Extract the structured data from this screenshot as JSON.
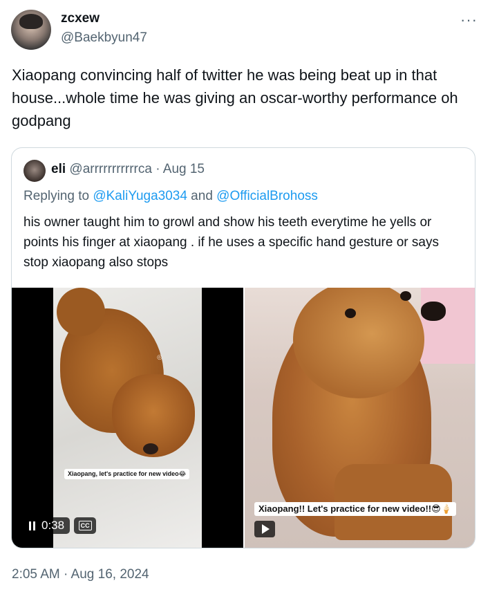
{
  "author": {
    "display_name": "zcxew",
    "handle": "@Baekbyun47"
  },
  "tweet": {
    "text": "Xiaopang convincing half of twitter he was being beat up in that house...whole time he was giving an oscar-worthy performance oh godpang",
    "timestamp": "2:05 AM · Aug 16, 2024"
  },
  "quote": {
    "name": "eli",
    "handle": "@arrrrrrrrrrrca",
    "date": "Aug 15",
    "separator": "·",
    "reply_prefix": "Replying to ",
    "reply_to_1": "@KaliYuga3034",
    "reply_and": " and ",
    "reply_to_2": "@OfficialBrohoss",
    "text": "his owner taught him to growl and show his teeth everytime he yells or points his finger at xiaopang . if he uses a specific hand gesture or says stop xiaopang also stops"
  },
  "media": {
    "left": {
      "caption": "Xiaopang, let's practice for new video😂",
      "duration": "0:38",
      "cc_label": "CC"
    },
    "right": {
      "caption": "Xiaopang!! Let's practice for new video!!😎🍦"
    }
  },
  "icons": {
    "more": "more-horizontal-icon",
    "pause": "pause-icon",
    "cc": "closed-captions-icon",
    "play": "play-icon"
  },
  "colors": {
    "text_primary": "#0f1419",
    "text_secondary": "#536471",
    "link": "#1d9bf0",
    "border": "#cfd9de"
  }
}
